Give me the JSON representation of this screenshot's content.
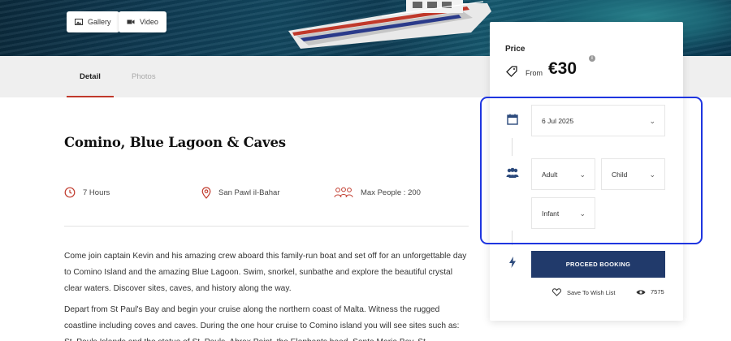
{
  "hero": {
    "gallery_label": "Gallery",
    "video_label": "Video"
  },
  "tabs": [
    {
      "label": "Detail",
      "active": true
    },
    {
      "label": "Photos",
      "active": false
    }
  ],
  "tour": {
    "title": "Comino, Blue Lagoon & Caves",
    "duration": "7 Hours",
    "location": "San Pawl il-Bahar",
    "max_people": "Max People : 200",
    "description": [
      "Come join captain Kevin and his amazing crew aboard this family-run boat and set off for an unforgettable day to Comino Island and the amazing Blue Lagoon. Swim, snorkel, sunbathe and explore the beautiful crystal clear waters. Discover sites, caves, and history along the way.",
      "Depart from St Paul's Bay and begin your cruise along the northern coast of Malta. Witness the rugged coastline including coves and caves. During the one hour cruise to Comino island you will see sites such as: St. Pauls Islands and the statue of St. Pauls, Ahrax Point, the Elephants head, Santa Maria Bay, St."
    ]
  },
  "booking": {
    "price_label": "Price",
    "from_label": "From",
    "price": "€30",
    "info_icon": "i",
    "date": "6 Jul 2025",
    "adult_label": "Adult",
    "child_label": "Child",
    "infant_label": "Infant",
    "proceed_label": "PROCEED BOOKING",
    "wishlist_label": "Save To Wish List",
    "views": "7575"
  },
  "colors": {
    "accent_red": "#c0392b",
    "button_navy": "#213a6b",
    "icon_navy": "#2c4a7c",
    "highlight_blue": "#1f36e0"
  }
}
